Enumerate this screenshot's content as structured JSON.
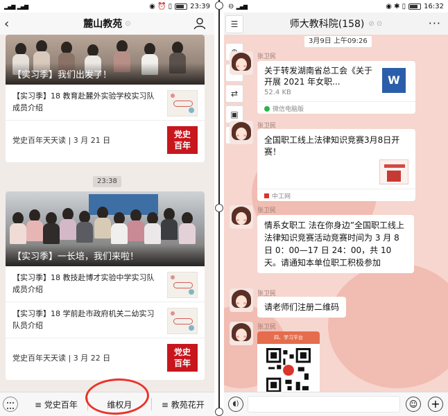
{
  "left": {
    "status": {
      "time": "23:39"
    },
    "title": "麓山教苑",
    "cards": [
      {
        "caption": "【实习季】我们出发了！",
        "articles": [
          "【实习季】18 教育赴麓外实验学校实习队成员介绍"
        ],
        "footer": "党史百年天天读 | 3 月 21 日",
        "badge": "党史\n百年"
      },
      {
        "caption": "【实习季】一长培，我们来啦！",
        "articles": [
          "【实习季】18 教技赴博才实验中学实习队成员介绍",
          "【实习季】18 学前赴市政府机关二幼实习队员介绍"
        ],
        "footer": "党史百年天天读 | 3 月 22 日",
        "badge": "党史\n百年"
      }
    ],
    "divider_time": "23:38",
    "menu": [
      "≡ 党史百年",
      "维权月",
      "≡ 教苑花开"
    ]
  },
  "right": {
    "status": {
      "time": "16:32"
    },
    "title": "师大教科院(158)",
    "date_label": "3月9日 上午09:26",
    "messages": [
      {
        "sender": "张卫民",
        "type": "file",
        "title": "关于转发湖南省总工会《关于开展 2021 年女职...",
        "size": "52.4 KB",
        "source": "微信电脑版",
        "icon_letter": "W"
      },
      {
        "sender": "张卫民",
        "type": "link",
        "title": "全国职工线上法律知识竞赛3月8日开赛！",
        "source": "中工网"
      },
      {
        "sender": "张卫民",
        "type": "text",
        "text": "情系女职工  法在你身边”全国职工线上法律知识竞赛活动竞赛时间为 3 月 8 日 0：00—17 日 24：00，共 10 天。请通知本单位职工积极参加"
      },
      {
        "sender": "张卫民",
        "type": "text",
        "text": "请老师们注册二维码"
      },
      {
        "sender": "张卫民",
        "type": "image",
        "poster_header": "四、学习平台"
      }
    ],
    "tools": [
      "crop-icon",
      "zoom-icon",
      "crop-icon",
      "convert-icon",
      "image-icon",
      "more-icon"
    ]
  },
  "colors": {
    "accent_red": "#c8161d",
    "circle_red": "#e8332b",
    "chat_bg": "#f6d6cf",
    "word_blue": "#2b5eaa"
  }
}
